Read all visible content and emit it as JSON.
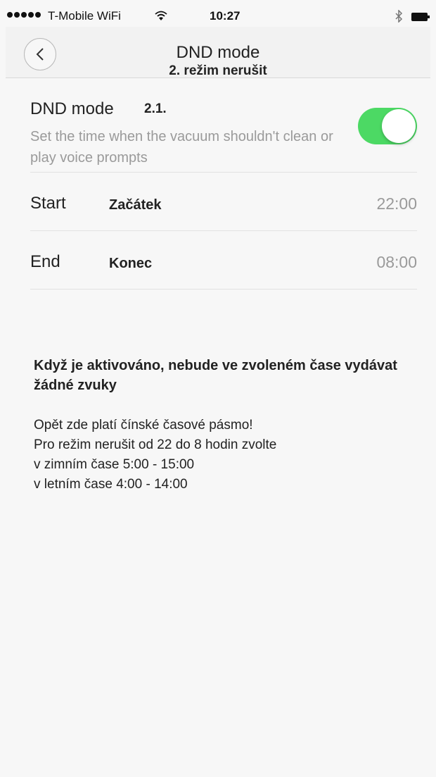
{
  "status_bar": {
    "carrier": "T-Mobile WiFi",
    "time": "10:27"
  },
  "header": {
    "title": "DND mode",
    "subtitle": "2. režim nerušit"
  },
  "dnd": {
    "label": "DND mode",
    "note": "2.1.",
    "description": "Set the time when the vacuum shouldn't clean or play voice prompts",
    "enabled": true,
    "toggle_color": "#4cd964"
  },
  "start": {
    "label": "Start",
    "note": "Začátek",
    "value": "22:00"
  },
  "end": {
    "label": "End",
    "note": "Konec",
    "value": "08:00"
  },
  "notes": {
    "heading": "Když je aktivováno, nebude ve zvoleném čase vydávat žádné zvuky",
    "lines": [
      "Opět zde platí čínské časové pásmo!",
      "Pro režim nerušit od 22 do 8 hodin zvolte",
      "v zimním čase 5:00 - 15:00",
      "v letním čase 4:00 - 14:00"
    ]
  }
}
